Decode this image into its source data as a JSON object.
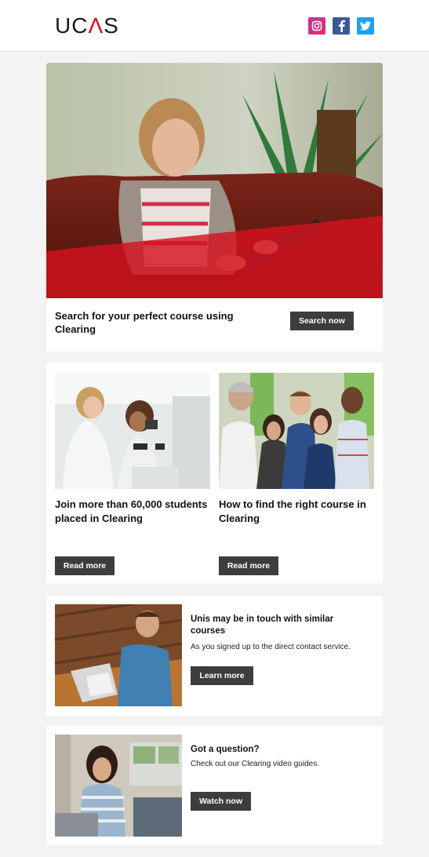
{
  "header": {
    "logo_left": "UC",
    "logo_caret": "Λ",
    "logo_right": "S",
    "social": [
      {
        "icon": "instagram-icon",
        "color": "#c2339d"
      },
      {
        "icon": "facebook-icon",
        "color": "#3b5998"
      },
      {
        "icon": "twitter-icon",
        "color": "#1da1f2"
      }
    ]
  },
  "hero": {
    "title": "Search for your perfect course using Clearing",
    "button": "Search now"
  },
  "features": [
    {
      "title": "Join more than 60,000 students placed in Clearing",
      "button": "Read more"
    },
    {
      "title": "How to find the right course in Clearing",
      "button": "Read more"
    }
  ],
  "contact": {
    "title": "Unis may be in touch with similar courses",
    "subtitle": "As you signed up to the direct contact service.",
    "button": "Learn more"
  },
  "question": {
    "title": "Got a question?",
    "subtitle": "Check out our Clearing video guides.",
    "button": "Watch now"
  },
  "colors": {
    "accent_red": "#e0001b",
    "button_bg": "#3d3d3d",
    "page_bg": "#f3f3f3"
  }
}
